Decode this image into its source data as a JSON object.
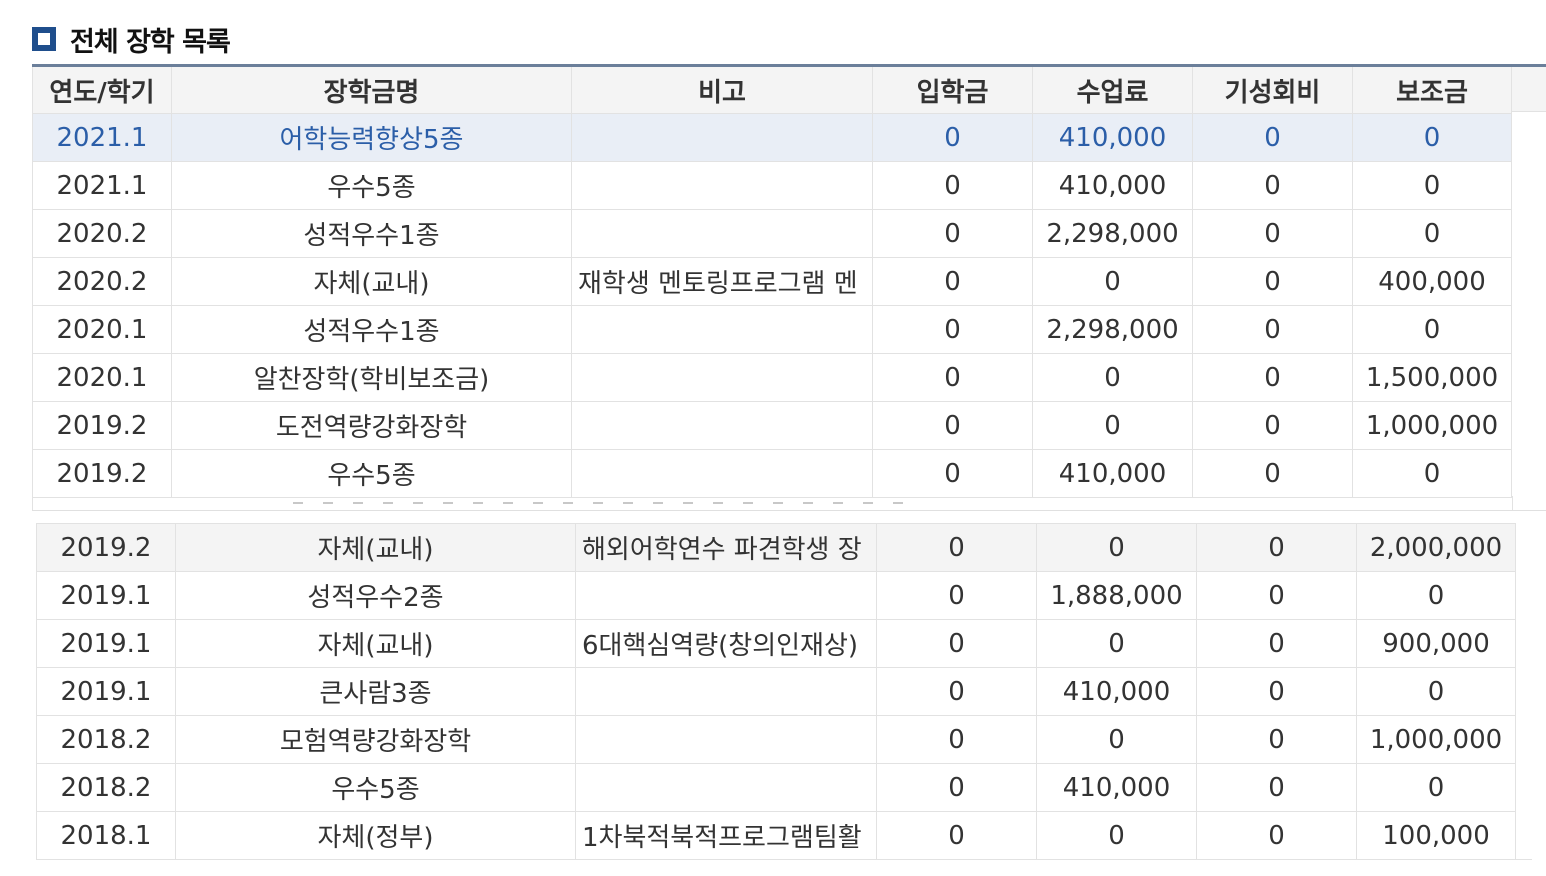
{
  "section_title": "전체 장학 목록",
  "columns": [
    "연도/학기",
    "장학금명",
    "비고",
    "입학금",
    "수업료",
    "기성회비",
    "보조금"
  ],
  "top_rows": [
    {
      "term": "2021.1",
      "name": "어학능력향상5종",
      "notes": "",
      "admission": "0",
      "tuition": "410,000",
      "support_fee": "0",
      "subsidy": "0"
    },
    {
      "term": "2021.1",
      "name": "우수5종",
      "notes": "",
      "admission": "0",
      "tuition": "410,000",
      "support_fee": "0",
      "subsidy": "0"
    },
    {
      "term": "2020.2",
      "name": "성적우수1종",
      "notes": "",
      "admission": "0",
      "tuition": "2,298,000",
      "support_fee": "0",
      "subsidy": "0"
    },
    {
      "term": "2020.2",
      "name": "자체(교내)",
      "notes": "재학생 멘토링프로그램 멘",
      "admission": "0",
      "tuition": "0",
      "support_fee": "0",
      "subsidy": "400,000"
    },
    {
      "term": "2020.1",
      "name": "성적우수1종",
      "notes": "",
      "admission": "0",
      "tuition": "2,298,000",
      "support_fee": "0",
      "subsidy": "0"
    },
    {
      "term": "2020.1",
      "name": "알찬장학(학비보조금)",
      "notes": "",
      "admission": "0",
      "tuition": "0",
      "support_fee": "0",
      "subsidy": "1,500,000"
    },
    {
      "term": "2019.2",
      "name": "도전역량강화장학",
      "notes": "",
      "admission": "0",
      "tuition": "0",
      "support_fee": "0",
      "subsidy": "1,000,000"
    },
    {
      "term": "2019.2",
      "name": "우수5종",
      "notes": "",
      "admission": "0",
      "tuition": "410,000",
      "support_fee": "0",
      "subsidy": "0"
    }
  ],
  "bottom_rows": [
    {
      "term": "2019.2",
      "name": "자체(교내)",
      "notes": "해외어학연수 파견학생 장",
      "admission": "0",
      "tuition": "0",
      "support_fee": "0",
      "subsidy": "2,000,000"
    },
    {
      "term": "2019.1",
      "name": "성적우수2종",
      "notes": "",
      "admission": "0",
      "tuition": "1,888,000",
      "support_fee": "0",
      "subsidy": "0"
    },
    {
      "term": "2019.1",
      "name": "자체(교내)",
      "notes": "6대핵심역량(창의인재상)",
      "admission": "0",
      "tuition": "0",
      "support_fee": "0",
      "subsidy": "900,000"
    },
    {
      "term": "2019.1",
      "name": "큰사람3종",
      "notes": "",
      "admission": "0",
      "tuition": "410,000",
      "support_fee": "0",
      "subsidy": "0"
    },
    {
      "term": "2018.2",
      "name": "모험역량강화장학",
      "notes": "",
      "admission": "0",
      "tuition": "0",
      "support_fee": "0",
      "subsidy": "1,000,000"
    },
    {
      "term": "2018.2",
      "name": "우수5종",
      "notes": "",
      "admission": "0",
      "tuition": "410,000",
      "support_fee": "0",
      "subsidy": "0"
    },
    {
      "term": "2018.1",
      "name": "자체(정부)",
      "notes": "1차북적북적프로그램팀활",
      "admission": "0",
      "tuition": "0",
      "support_fee": "0",
      "subsidy": "100,000"
    }
  ],
  "colors": {
    "header_bg": "#f4f4f4",
    "selected_bg": "#e9eef6",
    "selected_text": "#2b5ea8",
    "title_icon": "#1f4e8c",
    "header_top_border": "#6b7f9a"
  }
}
